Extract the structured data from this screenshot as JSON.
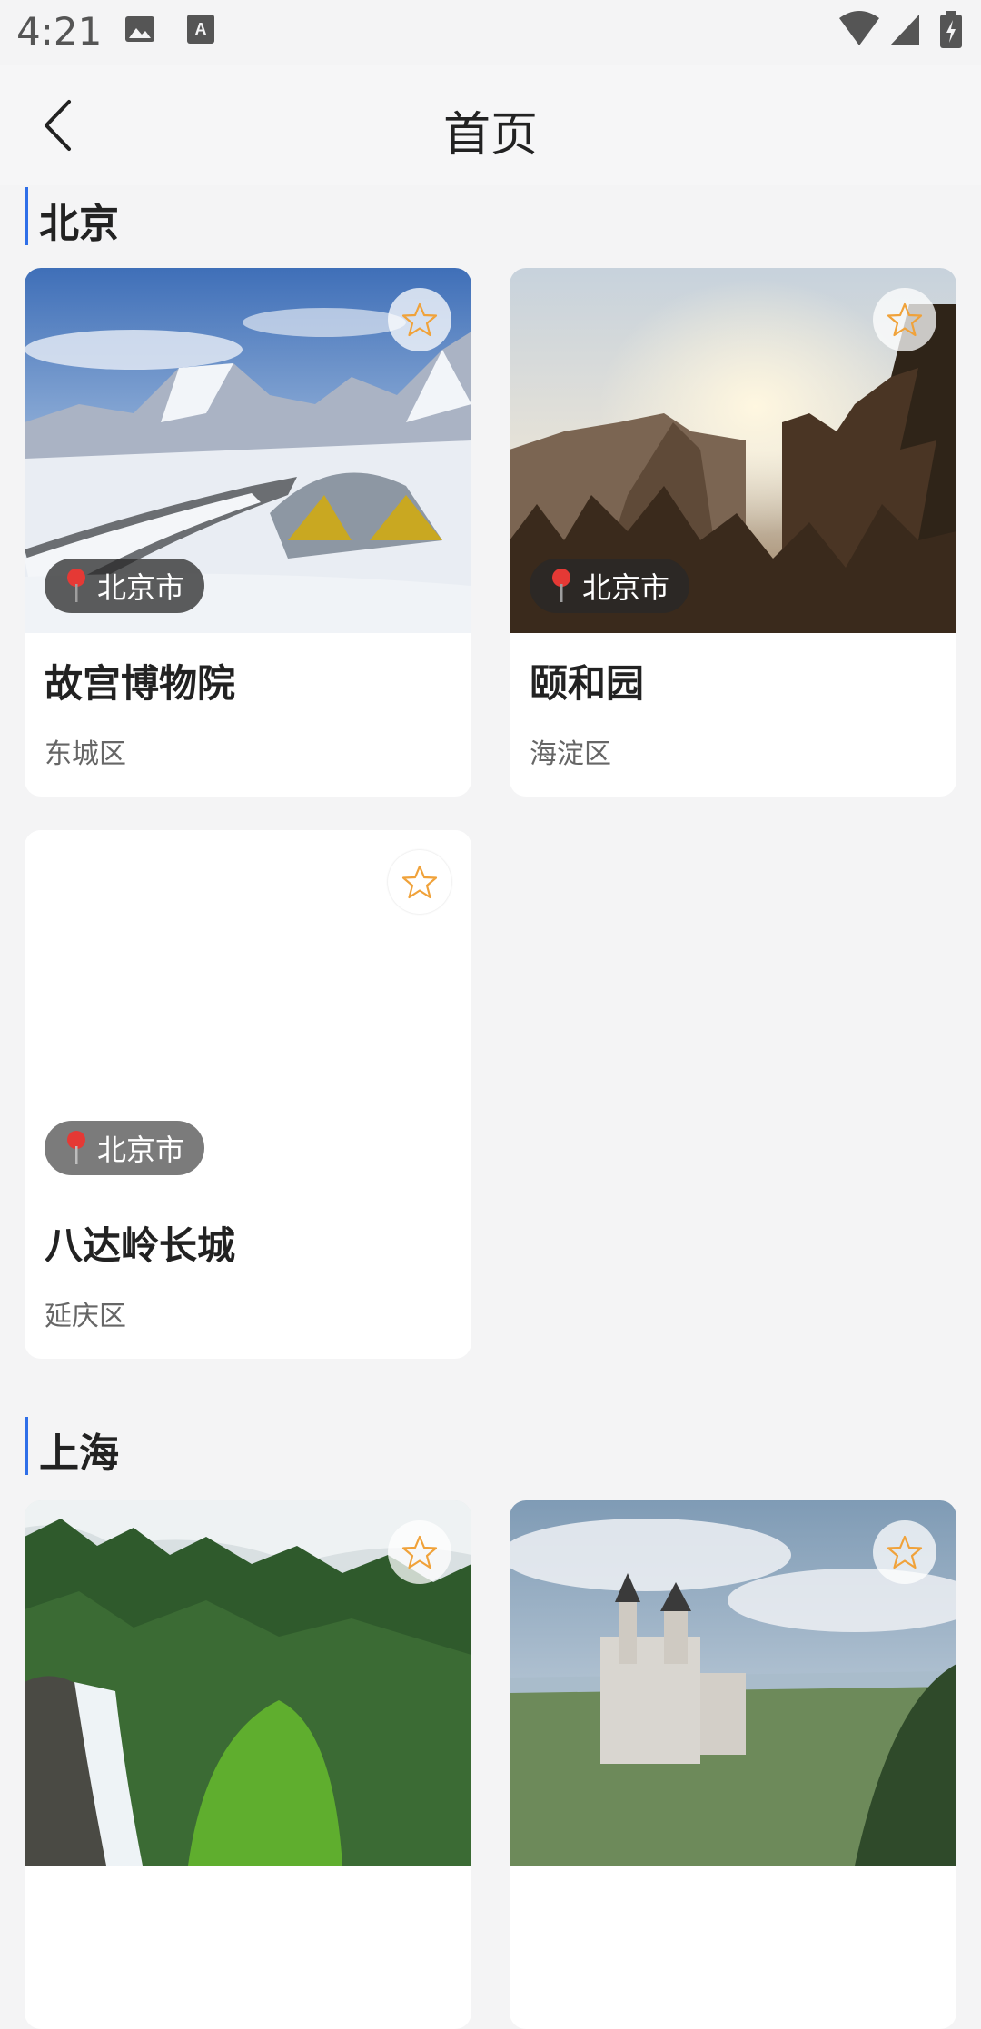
{
  "status_bar": {
    "time": "4:21",
    "icons": [
      "image-icon",
      "text-a-icon",
      "wifi-icon",
      "signal-icon",
      "battery-icon"
    ]
  },
  "header": {
    "title": "首页",
    "back_icon": "chevron-left-icon"
  },
  "colors": {
    "accent": "#2f6fe8",
    "star": "#f0a23a",
    "background": "#f4f4f5"
  },
  "sections": [
    {
      "title": "北京",
      "cards": [
        {
          "name": "故宫博物院",
          "district": "东城区",
          "city": "北京市",
          "image": "snow-mountain-tent"
        },
        {
          "name": "颐和园",
          "district": "海淀区",
          "city": "北京市",
          "image": "sunset-forest-mountain"
        },
        {
          "name": "八达岭长城",
          "district": "延庆区",
          "city": "北京市",
          "image": ""
        }
      ]
    },
    {
      "title": "上海",
      "cards": [
        {
          "image": "waterfall-forest"
        },
        {
          "image": "castle-landscape"
        }
      ]
    }
  ]
}
